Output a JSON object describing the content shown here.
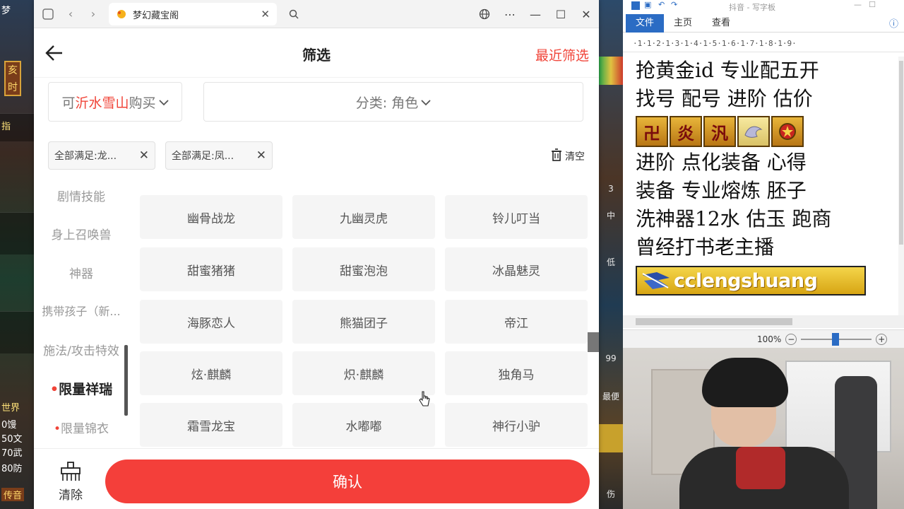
{
  "browser": {
    "tab_title": "梦幻藏宝阁",
    "window_controls": [
      "⊕",
      "⋯",
      "—",
      "☐",
      "✕"
    ]
  },
  "header": {
    "title": "筛选",
    "recent_filter": "最近筛选"
  },
  "filters": {
    "server_prefix": "可",
    "server_name": "沂水雪山",
    "server_suffix": "购买",
    "category_label": "分类: 角色",
    "chips": [
      "全部满足:龙...",
      "全部满足:凤..."
    ],
    "clear_all": "清空"
  },
  "categories": [
    {
      "label": "剧情技能",
      "active": false
    },
    {
      "label": "身上召唤兽",
      "active": false
    },
    {
      "label": "神器",
      "active": false
    },
    {
      "label": "携带孩子（新...",
      "active": false
    },
    {
      "label": "施法/攻击特效",
      "active": false
    },
    {
      "label": "限量祥瑞",
      "active": true
    },
    {
      "label": "限量锦衣",
      "active": false
    }
  ],
  "grid": [
    [
      "幽骨战龙",
      "九幽灵虎",
      "铃儿叮当"
    ],
    [
      "甜蜜猪猪",
      "甜蜜泡泡",
      "冰晶魅灵"
    ],
    [
      "海豚恋人",
      "熊猫团子",
      "帝江"
    ],
    [
      "炫·麒麟",
      "炽·麒麟",
      "独角马"
    ],
    [
      "霜雪龙宝",
      "水嘟嘟",
      "神行小驴"
    ]
  ],
  "footer": {
    "clear_label": "清除",
    "confirm_label": "确认"
  },
  "wordpad": {
    "title": "抖音 - 写字板",
    "tabs": [
      "文件",
      "主页",
      "查看"
    ],
    "ruler": "·1·1·2·1·3·1·4·1·5·1·6·1·7·1·8·1·9·",
    "lines": [
      "抢黄金id 专业配五开",
      "找号 配号 进阶 估价",
      "进阶 点化装备 心得",
      "装备 专业熔炼 胚子",
      "洗神器12水 估玉 跑商",
      "曾经打书老主播"
    ],
    "icon_glyphs": [
      "卍",
      "炎",
      "汎",
      "",
      ""
    ],
    "banner_text": "cclengshuang",
    "zoom": "100%"
  },
  "game_left": [
    "梦",
    "亥时",
    "指",
    "世界",
    "0馒",
    "50文",
    "70武",
    "80防",
    "传音"
  ],
  "game_mid": [
    "3",
    "中",
    "低",
    "99",
    "最便",
    "伤"
  ],
  "colors": {
    "accent_red": "#f04438",
    "confirm_bg": "#f43f3a",
    "wordpad_file_tab": "#2b6cc4"
  }
}
